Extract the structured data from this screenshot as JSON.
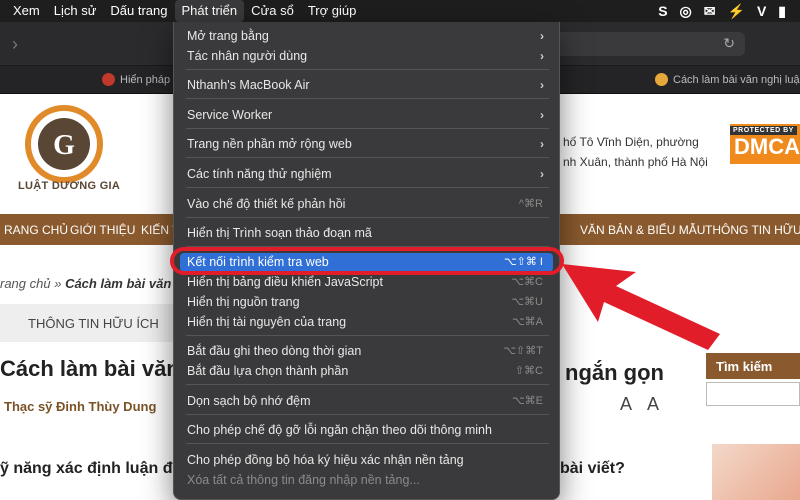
{
  "menubar": {
    "items": [
      "Xem",
      "Lịch sử",
      "Dấu trang",
      "Phát triển",
      "Cửa sổ",
      "Trợ giúp"
    ],
    "active_index": 3,
    "status_letters": [
      "S",
      "V"
    ]
  },
  "browser": {
    "tab_left": "Hiển pháp c",
    "tab_right": "Cách làm bài văn nghị luậ"
  },
  "page": {
    "logo": "LUẬT DƯƠNG GIA",
    "address_line1": "hố Tô Vĩnh Diện, phường",
    "address_line2": "nh Xuân, thành phố Hà Nội",
    "dmca_top": "PROTECTED BY",
    "dmca": "DMCA",
    "nav": [
      "RANG CHỦ",
      "GIỚI THIỆU",
      "KIẾN T",
      "VĂN BẢN & BIỂU MẪU",
      "THÔNG TIN HỮU Í"
    ],
    "breadcrumb_home": "rang chủ",
    "breadcrumb_sep": " » ",
    "breadcrumb_current": "Cách làm bài văn n",
    "info_box": "THÔNG TIN HỮU ÍCH",
    "title_left": "Cách làm bài văn",
    "title_right": "ngắn gọn",
    "author": "Thạc sỹ Đinh Thùy Dung",
    "font_controls": "A A",
    "section_left": "ỹ năng xác định luận đ",
    "section_right": "bài viết?",
    "search_title": "Tìm kiếm"
  },
  "menu": {
    "items": [
      {
        "label": "Mở trang bằng",
        "shortcut": "",
        "submenu": true
      },
      {
        "label": "Tác nhân người dùng",
        "shortcut": "",
        "submenu": true
      },
      {
        "label": "Nthanh's MacBook Air",
        "shortcut": "",
        "submenu": true
      },
      {
        "label": "Service Worker",
        "shortcut": "",
        "submenu": true
      },
      {
        "label": "Trang nền phần mở rộng web",
        "shortcut": "",
        "submenu": true
      },
      {
        "label": "Các tính năng thử nghiệm",
        "shortcut": "",
        "submenu": true
      },
      {
        "label": "Vào chế độ thiết kế phản hồi",
        "shortcut": "^⌘R",
        "submenu": false
      },
      {
        "label": "Hiển thị Trình soạn thảo đoạn mã",
        "shortcut": "",
        "submenu": false
      },
      {
        "label": "Kết nối trình kiểm tra web",
        "shortcut": "⌥⇧⌘ I",
        "submenu": false,
        "highlighted": true
      },
      {
        "label": "Hiển thị bảng điều khiển JavaScript",
        "shortcut": "⌥⌘C",
        "submenu": false
      },
      {
        "label": "Hiển thị nguồn trang",
        "shortcut": "⌥⌘U",
        "submenu": false
      },
      {
        "label": "Hiển thị tài nguyên của trang",
        "shortcut": "⌥⌘A",
        "submenu": false
      },
      {
        "label": "Bắt đầu ghi theo dòng thời gian",
        "shortcut": "⌥⇧⌘T",
        "submenu": false
      },
      {
        "label": "Bắt đầu lựa chọn thành phần",
        "shortcut": "⇧⌘C",
        "submenu": false
      },
      {
        "label": "Dọn sạch bộ nhớ đệm",
        "shortcut": "⌥⌘E",
        "submenu": false
      },
      {
        "label": "Cho phép chế độ gỡ lỗi ngăn chặn theo dõi thông minh",
        "shortcut": "",
        "submenu": false
      },
      {
        "label": "Cho phép đồng bộ hóa ký hiệu xác nhận nền tảng",
        "shortcut": "",
        "submenu": false
      },
      {
        "label": "Xóa tất cả thông tin đăng nhập nền tảng...",
        "shortcut": "",
        "submenu": false,
        "disabled": true
      }
    ]
  },
  "colors": {
    "highlight": "#2f6fd6",
    "callout": "#e11d2a",
    "brand_brown": "#8a5a2e"
  }
}
